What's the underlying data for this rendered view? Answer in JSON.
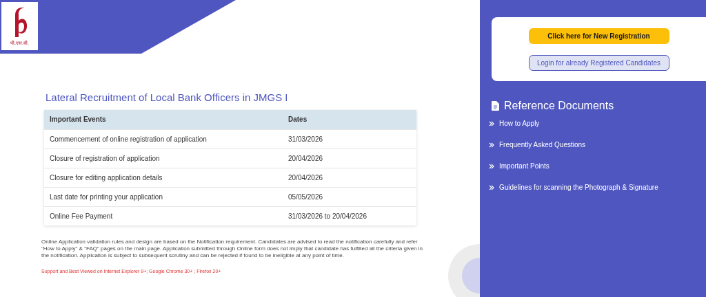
{
  "logo": {
    "caption": "पी.एस.बी."
  },
  "title": "Lateral Recruitment of Local Bank Officers in JMGS I",
  "table": {
    "columns": [
      "Important Events",
      "Dates"
    ],
    "rows": [
      [
        "Commencement of online registration of application",
        "31/03/2026"
      ],
      [
        "Closure of registration of application",
        "20/04/2026"
      ],
      [
        "Closure for editing application details",
        "20/04/2026"
      ],
      [
        "Last date for printing your application",
        "05/05/2026"
      ],
      [
        "Online Fee Payment",
        "31/03/2026 to 20/04/2026"
      ]
    ]
  },
  "note": "Online Application validation rules and design are based on the Notification requirement. Candidates are advised to read the notification carefully and refer \"How to Apply\" & \"FAQ\" pages on the main page. Application submitted through Online form does not imply that candidate has fulfilled all the criteria given in the notification. Application is subject to subsequent scrutiny and can be rejected if found to be ineligible at any point of time.",
  "browser_support": "Support and Best Viewed on Internet Explorer 9+; Google Chrome 30+ ; Firefox 20+",
  "buttons": [
    {
      "label": "Click here for New Registration",
      "kind": "primary"
    },
    {
      "label": "Login for already Registered Candidates",
      "kind": "secondary"
    }
  ],
  "reference": {
    "heading": "Reference Documents",
    "links": [
      "How to Apply",
      "Frequently Asked Questions",
      "Important Points",
      "Guidelines for scanning the Photograph & Signature"
    ]
  }
}
